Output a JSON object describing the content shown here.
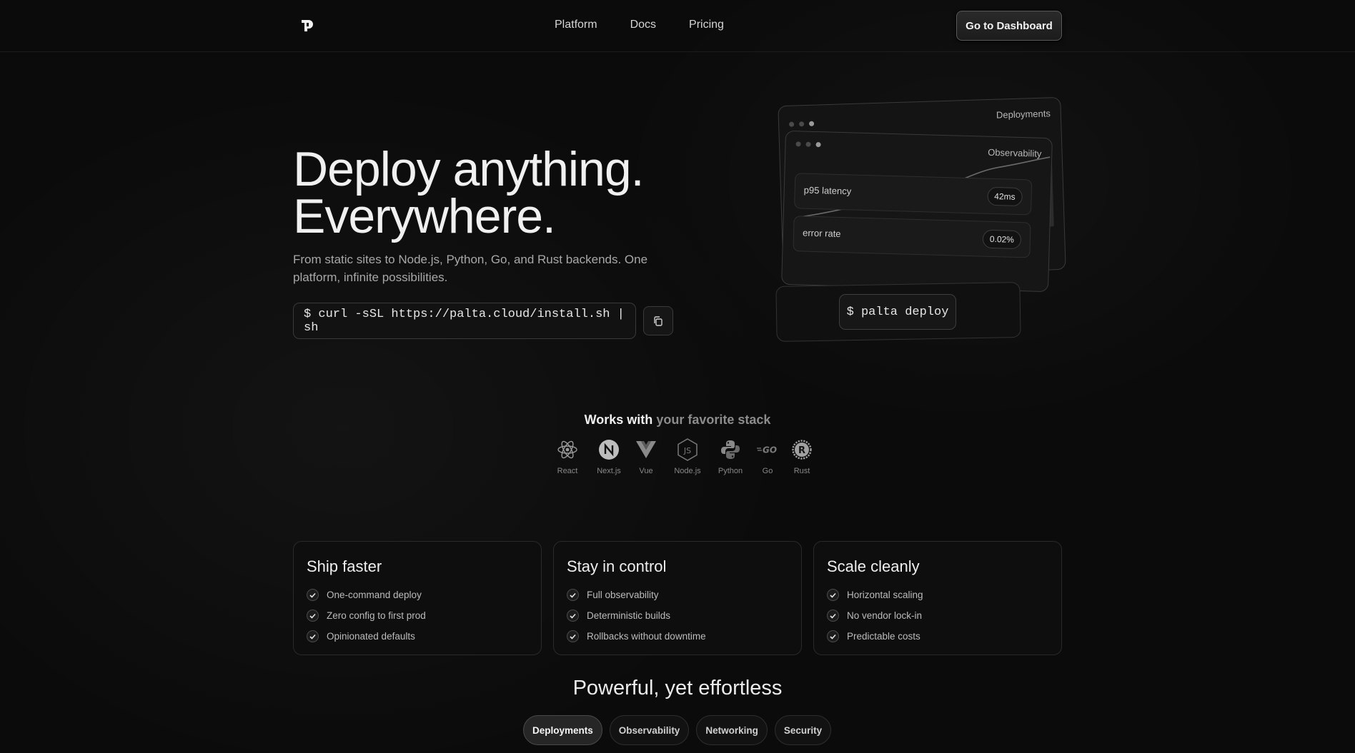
{
  "nav": {
    "links": [
      "Platform",
      "Docs",
      "Pricing"
    ],
    "cta": "Go to Dashboard"
  },
  "hero": {
    "title_line1": "Deploy anything.",
    "title_line2": "Everywhere.",
    "subtitle": "From static sites to Node.js, Python, Go, and Rust backends. One platform, infinite possibilities.",
    "install_cmd": "$ curl -sSL https://palta.cloud/install.sh | sh"
  },
  "preview": {
    "back_title": "Deployments",
    "mid_title": "Observability",
    "metrics": [
      {
        "label": "p95 latency",
        "value": "42ms"
      },
      {
        "label": "error rate",
        "value": "0.02%"
      }
    ],
    "deploy_cmd": "$ palta deploy"
  },
  "stack": {
    "heading_bold": "Works with",
    "heading_muted": "your favorite stack",
    "items": [
      {
        "label": "React",
        "icon": "react-icon"
      },
      {
        "label": "Next.js",
        "icon": "nextjs-icon"
      },
      {
        "label": "Vue",
        "icon": "vue-icon"
      },
      {
        "label": "Node.js",
        "icon": "nodejs-icon"
      },
      {
        "label": "Python",
        "icon": "python-icon"
      },
      {
        "label": "Go",
        "icon": "go-icon"
      },
      {
        "label": "Rust",
        "icon": "rust-icon"
      }
    ]
  },
  "features": [
    {
      "title": "Ship faster",
      "items": [
        "One-command deploy",
        "Zero config to first prod",
        "Opinionated defaults"
      ]
    },
    {
      "title": "Stay in control",
      "items": [
        "Full observability",
        "Deterministic builds",
        "Rollbacks without downtime"
      ]
    },
    {
      "title": "Scale cleanly",
      "items": [
        "Horizontal scaling",
        "No vendor lock-in",
        "Predictable costs"
      ]
    }
  ],
  "powerful": {
    "heading": "Powerful, yet effortless",
    "tabs": [
      "Deployments",
      "Observability",
      "Networking",
      "Security"
    ],
    "active_tab": "Deployments"
  },
  "colors": {
    "background": "#0b0b0b",
    "text": "#e9e9e9",
    "muted": "#a8a8a8",
    "border": "#2a2a2a"
  }
}
